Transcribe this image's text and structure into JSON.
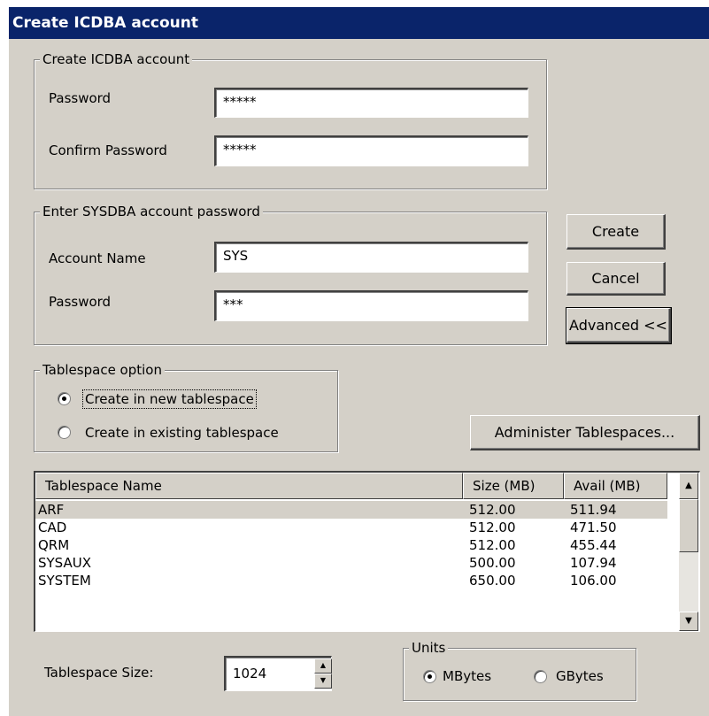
{
  "window": {
    "title": "Create ICDBA account"
  },
  "icdba_group": {
    "legend": "Create ICDBA account",
    "password_label": "Password",
    "password_value": "*****",
    "confirm_label": "Confirm Password",
    "confirm_value": "*****"
  },
  "sysdba_group": {
    "legend": "Enter SYSDBA account password",
    "account_label": "Account Name",
    "account_value": "SYS",
    "password_label": "Password",
    "password_value": "***"
  },
  "buttons": {
    "create": "Create",
    "cancel": "Cancel",
    "advanced": "Advanced <<",
    "administer": "Administer Tablespaces..."
  },
  "tablespace_option": {
    "legend": "Tablespace option",
    "new_label": "Create in new tablespace",
    "existing_label": "Create in existing tablespace",
    "selected": "new"
  },
  "table": {
    "headers": [
      "Tablespace Name",
      "Size (MB)",
      "Avail (MB)"
    ],
    "rows": [
      {
        "name": "ARF",
        "size": "512.00",
        "avail": "511.94"
      },
      {
        "name": "CAD",
        "size": "512.00",
        "avail": "471.50"
      },
      {
        "name": "QRM",
        "size": "512.00",
        "avail": "455.44"
      },
      {
        "name": "SYSAUX",
        "size": "500.00",
        "avail": "107.94"
      },
      {
        "name": "SYSTEM",
        "size": "650.00",
        "avail": "106.00"
      }
    ],
    "selected_row": 0
  },
  "tablespace_size": {
    "label": "Tablespace Size:",
    "value": "1024"
  },
  "units": {
    "legend": "Units",
    "mbytes": "MBytes",
    "gbytes": "GBytes",
    "selected": "MBytes"
  },
  "icons": {
    "scroll_up": "scroll-up-arrow-icon",
    "scroll_down": "scroll-down-arrow-icon",
    "spin_up": "spin-up-arrow-icon",
    "spin_down": "spin-down-arrow-icon"
  },
  "colors": {
    "titlebar": "#0a246a",
    "dialog": "#d4d0c8",
    "selection": "#d4d0c8"
  }
}
